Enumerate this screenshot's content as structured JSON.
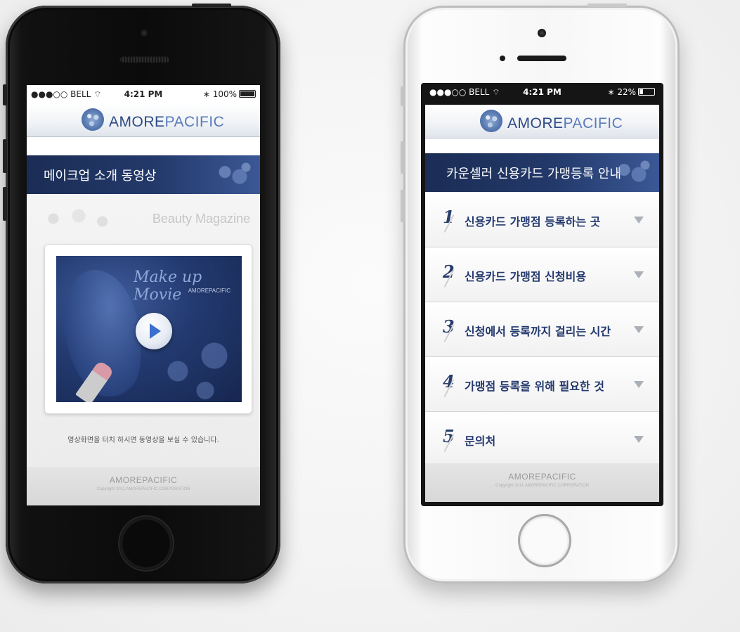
{
  "status_bar": {
    "carrier": "●●●○○ BELL",
    "time": "4:21 PM",
    "battery_black": "100%",
    "battery_white": "22%"
  },
  "brand": {
    "amore": "AMORE",
    "pacific": "PACIFIC"
  },
  "phone_black": {
    "title": "메이크업 소개 동영상",
    "magazine_label": "Beauty Magazine",
    "video_title": "Make up Movie",
    "video_subtitle": "AMOREPACIFIC",
    "hint": "영상화면을 터치 하시면 동영상을 보실 수 있습니다.",
    "footer_logo": "AMOREPACIFIC",
    "footer_copy": "Copyright 2011 AMOREPACIFIC CORPORATION"
  },
  "phone_white": {
    "title": "카운셀러 신용카드 가맹등록 안내",
    "items": [
      {
        "num": "1",
        "label": "신용카드 가맹점 등록하는 곳"
      },
      {
        "num": "2",
        "label": "신용카드 가맹점 신청비용"
      },
      {
        "num": "3",
        "label": "신청에서 등록까지 걸리는 시간"
      },
      {
        "num": "4",
        "label": "가맹점 등록을 위해 필요한 것"
      },
      {
        "num": "5",
        "label": "문의처"
      }
    ],
    "footer_logo": "AMOREPACIFIC",
    "footer_copy": "Copyright 2011 AMOREPACIFIC CORPORATION"
  },
  "colors": {
    "navy": "#23396a",
    "brand_blue": "#2d4a86",
    "accent_blue": "#3b6fd0"
  },
  "icons": [
    "wifi-icon",
    "bluetooth-icon",
    "battery-icon",
    "play-icon",
    "chevron-down-icon",
    "logo-emblem-icon"
  ]
}
